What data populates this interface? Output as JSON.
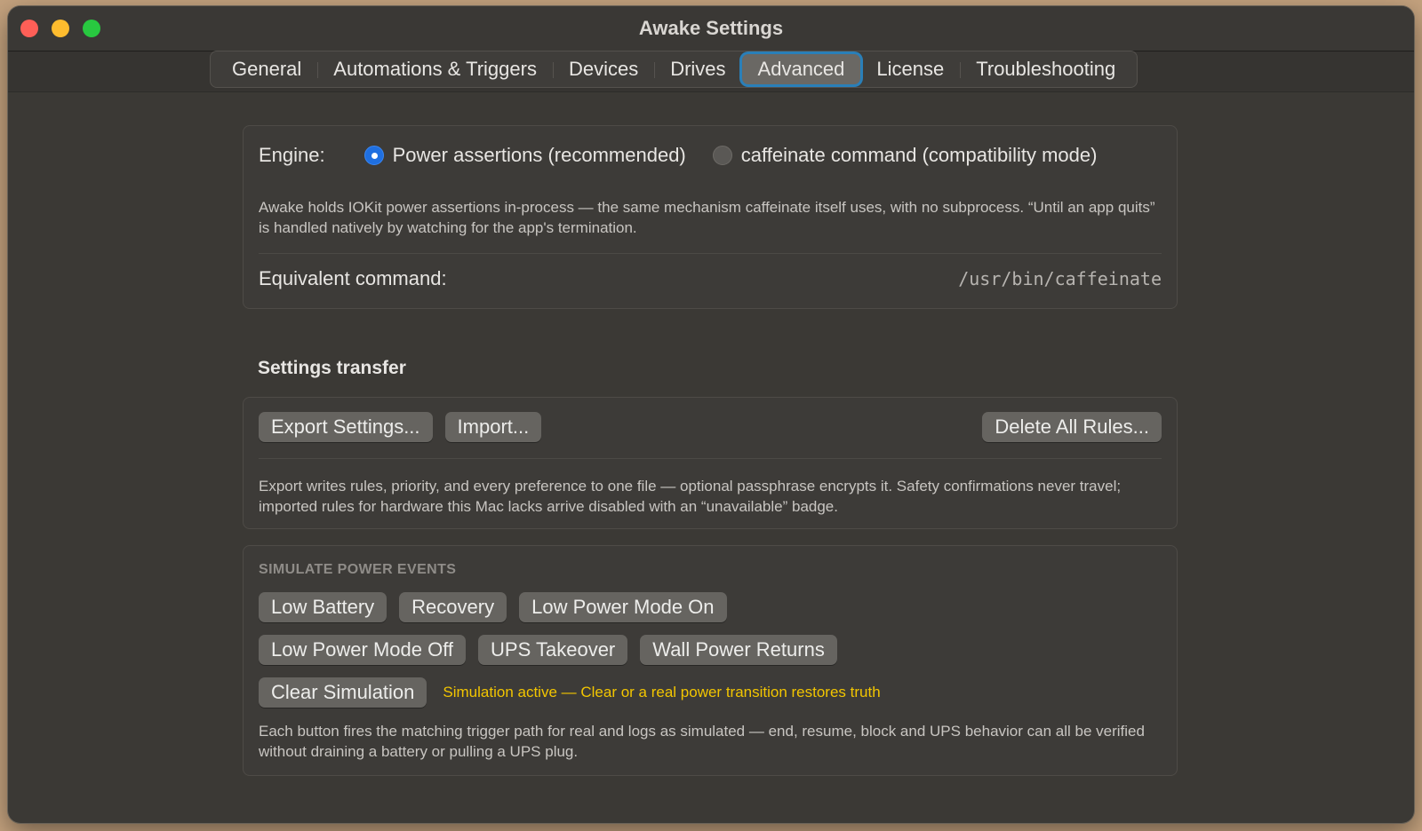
{
  "window": {
    "title": "Awake Settings"
  },
  "tabs": [
    {
      "label": "General"
    },
    {
      "label": "Automations & Triggers"
    },
    {
      "label": "Devices"
    },
    {
      "label": "Drives"
    },
    {
      "label": "Advanced"
    },
    {
      "label": "License"
    },
    {
      "label": "Troubleshooting"
    }
  ],
  "active_tab": "Advanced",
  "engine": {
    "label": "Engine:",
    "option_power": "Power assertions (recommended)",
    "option_caffeinate": "caffeinate command (compatibility mode)",
    "selected": "Power assertions (recommended)",
    "description": "Awake holds IOKit power assertions in-process — the same mechanism caffeinate itself uses, with no subprocess. “Until an app quits” is handled natively by watching for the app's termination.",
    "equiv_label": "Equivalent command:",
    "equiv_value": "/usr/bin/caffeinate"
  },
  "transfer": {
    "heading": "Settings transfer",
    "export_button": "Export Settings...",
    "import_button": "Import...",
    "delete_button": "Delete All Rules...",
    "description": "Export writes rules, priority, and every preference to one file — optional passphrase encrypts it. Safety confirmations never travel; imported rules for hardware this Mac lacks arrive disabled with an “unavailable” badge."
  },
  "simulate": {
    "heading": "SIMULATE POWER EVENTS",
    "buttons": {
      "low_battery": "Low Battery",
      "recovery": "Recovery",
      "low_power_on": "Low Power Mode On",
      "low_power_off": "Low Power Mode Off",
      "ups_takeover": "UPS Takeover",
      "wall_power": "Wall Power Returns",
      "clear": "Clear Simulation"
    },
    "status": "Simulation active — Clear or a real power transition restores truth",
    "status_color": "#f2c500",
    "description": "Each button fires the matching trigger path for real and logs as simulated — end, resume, block and UPS behavior can all be verified without draining a battery or pulling a UPS plug."
  },
  "colors": {
    "accent": "#1f6fe0",
    "tab_focus": "#2a7fb8",
    "window_bg": "#3b3935"
  }
}
